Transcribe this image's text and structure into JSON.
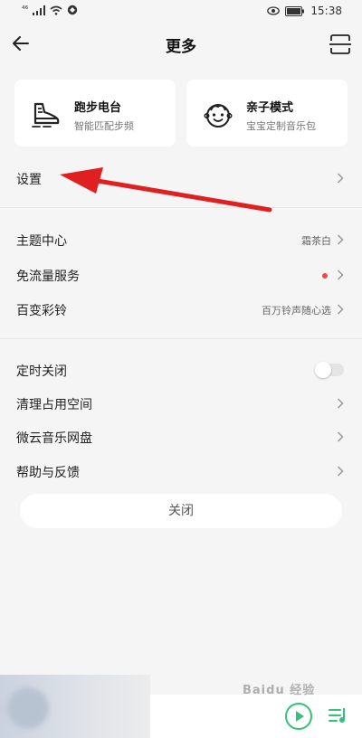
{
  "status_bar": {
    "signal": "⁴⁶",
    "time": "15:38"
  },
  "header": {
    "title": "更多"
  },
  "cards": [
    {
      "title": "跑步电台",
      "subtitle": "智能匹配步频",
      "icon": "running-shoe-icon"
    },
    {
      "title": "亲子模式",
      "subtitle": "宝宝定制音乐包",
      "icon": "baby-face-icon"
    }
  ],
  "settings": {
    "label": "设置"
  },
  "group1": [
    {
      "label": "主题中心",
      "value": "霜茶白"
    },
    {
      "label": "免流量服务",
      "value": ""
    },
    {
      "label": "百变彩铃",
      "value": "百万铃声随心选"
    }
  ],
  "group2": [
    {
      "label": "定时关闭",
      "toggle_on": false
    },
    {
      "label": "清理占用空间"
    },
    {
      "label": "微云音乐网盘"
    },
    {
      "label": "帮助与反馈"
    }
  ],
  "close_label": "关闭",
  "watermark": "Baidu 经验",
  "colors": {
    "accent_green": "#31c27c",
    "arrow_red": "#e02020",
    "badge_red": "#e74c4c"
  }
}
